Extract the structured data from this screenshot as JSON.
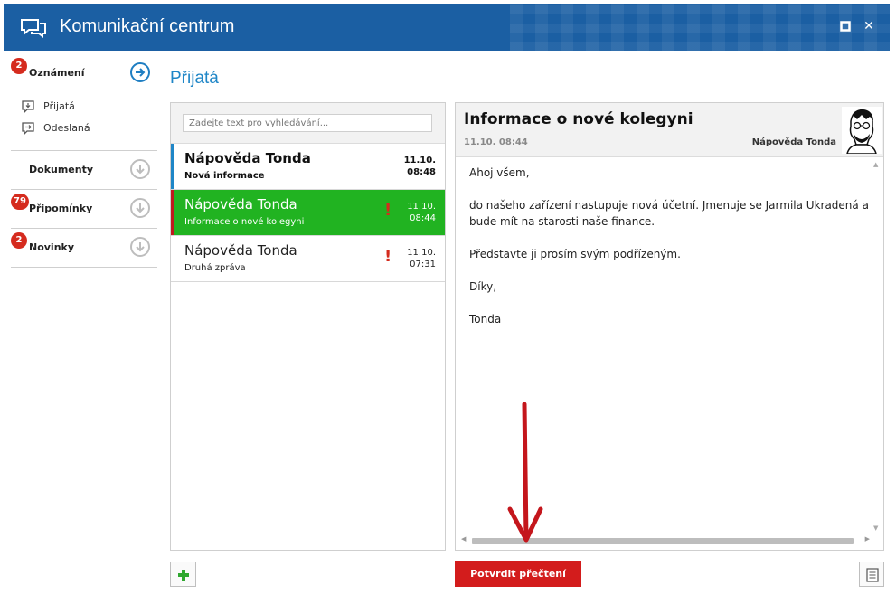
{
  "window": {
    "title": "Komunikační centrum",
    "icon": "chat-bubbles-icon",
    "buttons": [
      "maximize-icon",
      "close-icon"
    ],
    "close_label": "✕"
  },
  "sidebar": {
    "sections": [
      {
        "label": "Oznámení",
        "badge": "2",
        "icon": "arrow-right-circle-icon",
        "expanded": true,
        "items": [
          {
            "label": "Přijatá",
            "icon": "inbox-icon"
          },
          {
            "label": "Odeslaná",
            "icon": "sent-icon"
          }
        ]
      },
      {
        "label": "Dokumenty",
        "badge": "",
        "icon": "arrow-down-circle-icon"
      },
      {
        "label": "Připomínky",
        "badge": "79",
        "icon": "arrow-down-circle-icon"
      },
      {
        "label": "Novinky",
        "badge": "2",
        "icon": "arrow-down-circle-icon"
      }
    ]
  },
  "main": {
    "section_title": "Přijatá",
    "search": {
      "placeholder": "Zadejte text pro vyhledávání...",
      "value": ""
    },
    "messages": [
      {
        "from": "Nápověda Tonda",
        "subject": "Nová informace",
        "date": "11.10.",
        "time": "08:48",
        "unread": true,
        "important": false,
        "accent": "#1f86c7"
      },
      {
        "from": "Nápověda Tonda",
        "subject": "Informace o nové kolegyni",
        "date": "11.10.",
        "time": "08:44",
        "unread": false,
        "important": true,
        "selected": true,
        "accent": "#c0191e"
      },
      {
        "from": "Nápověda Tonda",
        "subject": "Druhá zpráva",
        "date": "11.10.",
        "time": "07:31",
        "unread": false,
        "important": true
      }
    ],
    "important_mark": "!"
  },
  "reader": {
    "title": "Informace o nové kolegyni",
    "date": "11.10. 08:44",
    "sender": "Nápověda Tonda",
    "body": [
      "Ahoj všem,",
      "do našeho zařízení nastupuje nová účetní. Jmenuje se Jarmila Ukradená a bude mít na starosti naše finance.",
      "Představte ji prosím svým podřízeným.",
      "Díky,",
      "Tonda"
    ]
  },
  "footer": {
    "confirm_label": "Potvrdit přečtení",
    "add_icon": "plus-icon",
    "doc_icon": "document-icon"
  },
  "colors": {
    "titlebar": "#1b5fa3",
    "accent_blue": "#1f86c7",
    "selected_green": "#21b321",
    "badge_red": "#d52b1e",
    "confirm_red": "#d31c1c"
  }
}
